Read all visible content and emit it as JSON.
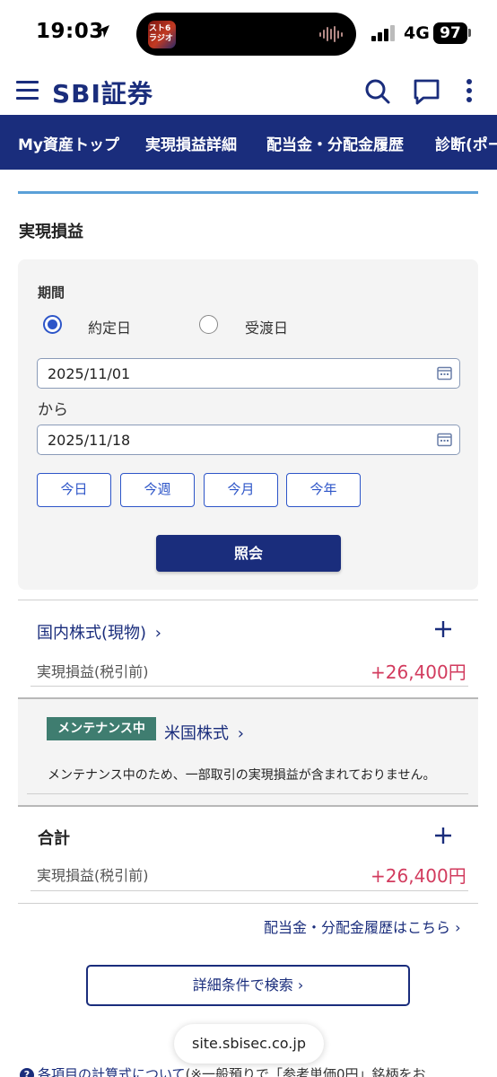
{
  "status_bar": {
    "time": "19:03",
    "network": "4G",
    "battery": "97",
    "now_playing_line1": "スト6",
    "now_playing_line2": "ラジオ"
  },
  "header": {
    "logo": "SBI証券",
    "icons": [
      "menu-icon",
      "search-icon",
      "chat-icon",
      "more-vertical-icon"
    ]
  },
  "nav": {
    "items": [
      "My資産トップ",
      "実現損益詳細",
      "配当金・分配金履歴",
      "診断(ポートフォリオ)"
    ]
  },
  "page": {
    "section_title": "実現損益"
  },
  "filter": {
    "period_label": "期間",
    "radio_options": [
      {
        "label": "約定日",
        "selected": true
      },
      {
        "label": "受渡日",
        "selected": false
      }
    ],
    "date_from": "2025/11/01",
    "from_label": "から",
    "date_to": "2025/11/18",
    "quick_buttons": [
      "今日",
      "今週",
      "今月",
      "今年"
    ],
    "submit_label": "照会"
  },
  "results": {
    "domestic": {
      "title": "国内株式(現物)",
      "chevron": "›",
      "label": "実現損益(税引前)",
      "amount": "+26,400円"
    },
    "us": {
      "badge": "メンテナンス中",
      "title": "米国株式",
      "chevron": "›",
      "note": "メンテナンス中のため、一部取引の実現損益が含まれておりません。"
    },
    "total": {
      "title": "合計",
      "label": "実現損益(税引前)",
      "amount": "+26,400円"
    }
  },
  "links": {
    "dividend_history": "配当金・分配金履歴はこちら ›",
    "detail_search": "詳細条件で検索 ›"
  },
  "browser": {
    "url": "site.sbisec.co.jp"
  },
  "footer_note": {
    "link": "各項目の計算式について",
    "text": "(※一般預りで「参考単価0円」銘柄をお"
  },
  "colors": {
    "brand_navy": "#1a2d7c",
    "accent_blue": "#2d55c8",
    "profit_red": "#d23b5e",
    "maintenance_green": "#3f7d70",
    "rule_blue": "#5aa0d8"
  }
}
